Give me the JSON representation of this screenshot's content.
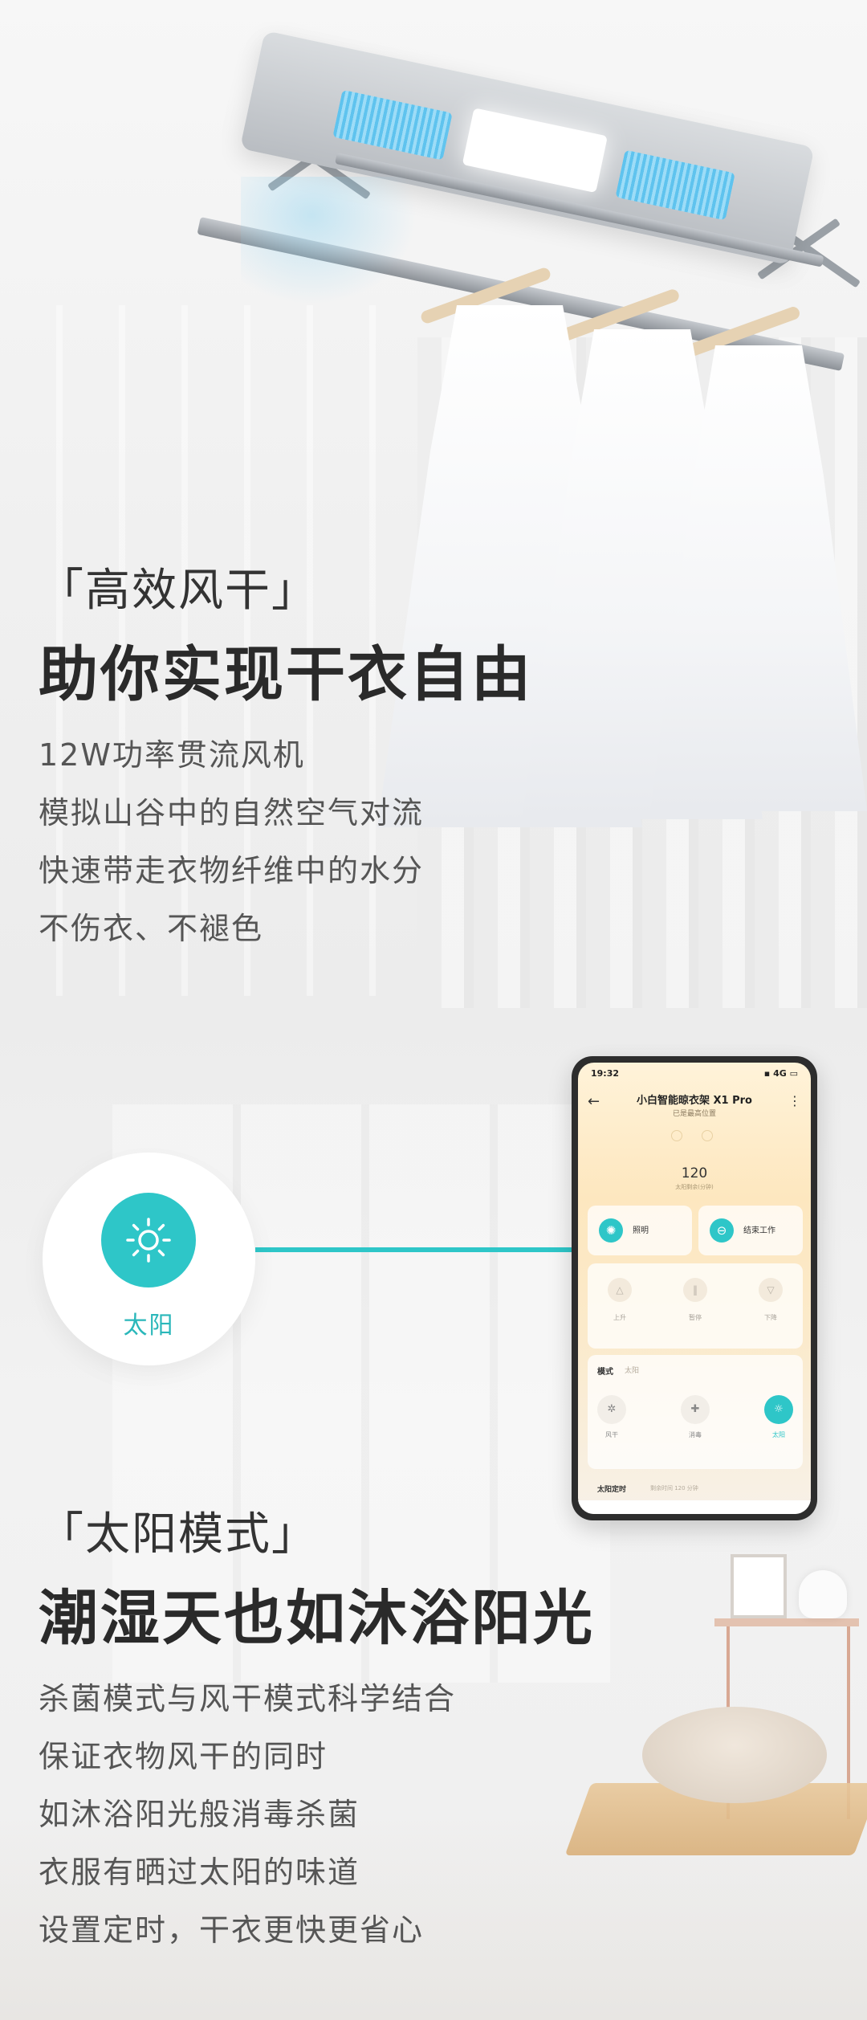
{
  "section1": {
    "title": "「高效风干」",
    "headline": "助你实现干衣自由",
    "lines": [
      "12W功率贯流风机",
      "模拟山谷中的自然空气对流",
      "快速带走衣物纤维中的水分",
      "不伤衣、不褪色"
    ]
  },
  "section2": {
    "callout_label": "太阳",
    "title": "「太阳模式」",
    "headline": "潮湿天也如沐浴阳光",
    "lines": [
      "杀菌模式与风干模式科学结合",
      "保证衣物风干的同时",
      "如沐浴阳光般消毒杀菌",
      "衣服有晒过太阳的味道",
      "设置定时，干衣更快更省心"
    ]
  },
  "phone": {
    "status_time": "19:32",
    "status_right": "▪ 4G ▭",
    "back_icon": "←",
    "more_icon": "⋮",
    "device_title": "小白智能晾衣架 X1 Pro",
    "device_subtitle": "已是最高位置",
    "big_number": "120",
    "big_number_sub": "太阳剩余(分钟)",
    "light_label": "照明",
    "end_label": "结束工作",
    "lift_up": "上升",
    "lift_pause": "暂停",
    "lift_down": "下降",
    "mode_title": "模式",
    "mode_sub": "太阳",
    "mode_wind": "风干",
    "mode_sterilize": "消毒",
    "mode_sun": "太阳",
    "timer_title": "太阳定时",
    "timer_sub": "剩余时间 120 分钟"
  },
  "colors": {
    "accent_teal": "#2ec6c8",
    "phone_bg": "#fde7bf"
  },
  "icons": {
    "sun": "sun-icon",
    "bulb": "lightbulb-icon",
    "stop": "stop-icon",
    "wind": "wind-icon",
    "sterilize": "plus-shield-icon"
  }
}
